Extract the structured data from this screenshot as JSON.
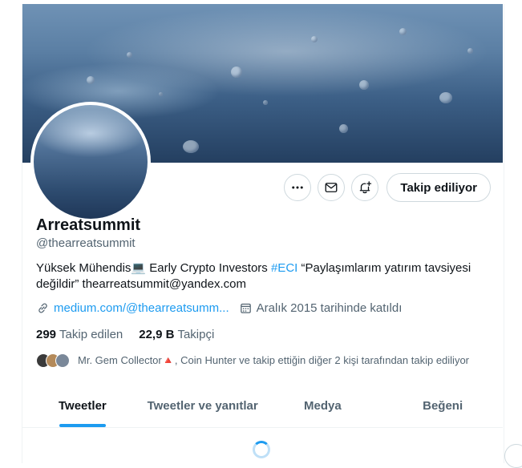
{
  "profile": {
    "name": "Arreatsummit",
    "handle": "@thearreatsummit",
    "bio": {
      "part1": "Yüksek Mühendis💻 Early Crypto Investors ",
      "hashtag": "#ECI",
      "part2": " “Paylaşımlarım yatırım tavsiyesi değildir” thearreatsummit@yandex.com"
    },
    "website": "medium.com/@thearreatsumm...",
    "joined": "Aralık 2015 tarihinde katıldı",
    "following_count": "299",
    "following_label": "Takip edilen",
    "followers_count": "22,9 B",
    "followers_label": "Takipçi",
    "followers_you_know": "Mr. Gem Collector🔺, Coin Hunter ve takip ettiğin diğer 2 kişi tarafından takip ediliyor"
  },
  "actions": {
    "more_icon": "more-horizontal-icon",
    "message_icon": "mail-icon",
    "notify_icon": "bell-plus-icon",
    "follow_label": "Takip ediliyor"
  },
  "tabs": [
    {
      "label": "Tweetler",
      "active": true
    },
    {
      "label": "Tweetler ve yanıtlar",
      "active": false
    },
    {
      "label": "Medya",
      "active": false
    },
    {
      "label": "Beğeni",
      "active": false
    }
  ],
  "colors": {
    "accent": "#1d9bf0",
    "text": "#0f1419",
    "secondary": "#536471"
  }
}
